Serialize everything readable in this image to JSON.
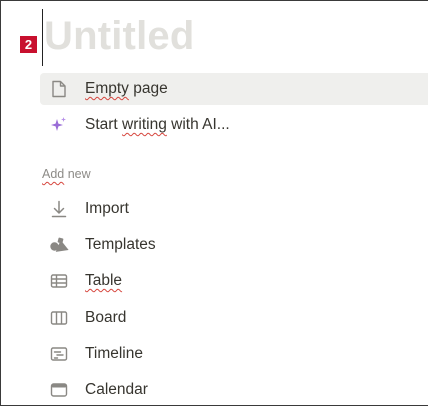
{
  "badge": "2",
  "title_placeholder": "Untitled",
  "options": [
    {
      "label_pre": "",
      "label_sq": "Empty",
      "label_mid": " ",
      "label_sq2": "page",
      "label_post": "",
      "icon": "page-icon"
    },
    {
      "label_pre": "Start ",
      "label_sq": "writing",
      "label_mid": " with AI...",
      "label_sq2": "",
      "label_post": "",
      "icon": "ai-sparkle-icon"
    }
  ],
  "section": {
    "label_sq": "Add",
    "label_post": " new"
  },
  "add_new": [
    {
      "label": "Import",
      "icon": "import-icon"
    },
    {
      "label": "Templates",
      "icon": "templates-icon"
    },
    {
      "label": "Table",
      "icon": "table-icon"
    },
    {
      "label": "Board",
      "icon": "board-icon"
    },
    {
      "label": "Timeline",
      "icon": "timeline-icon"
    },
    {
      "label": "Calendar",
      "icon": "calendar-icon"
    }
  ]
}
